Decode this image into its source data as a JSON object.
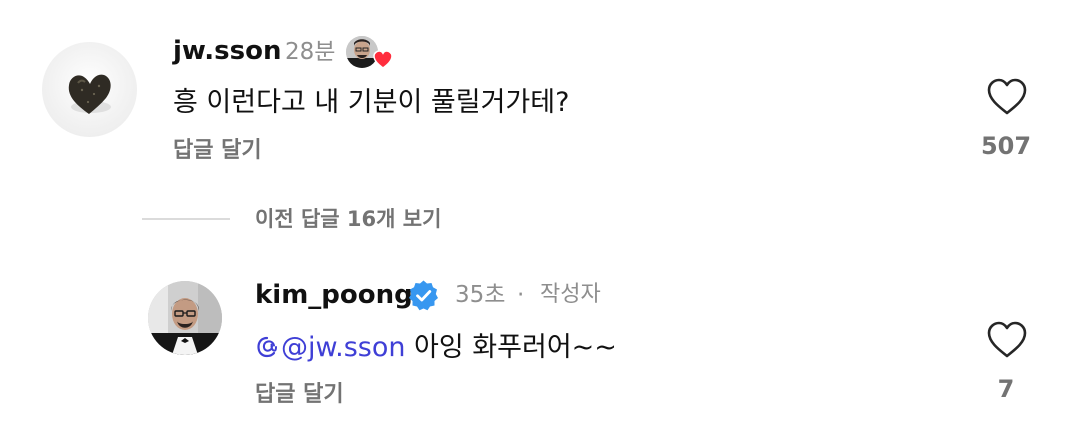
{
  "comments": [
    {
      "username": "jw.sson",
      "time": "28분",
      "text": "흥 이런다고 내 기분이 풀릴거가테?",
      "reply_label": "답글 달기",
      "like_count": "507",
      "liked_by_author": true
    },
    {
      "username": "kim_poong",
      "verified": true,
      "time": "35초",
      "separator": "·",
      "author_badge": "작성자",
      "mention": "@jw.sson",
      "text": " 아잉 화푸러어~~",
      "reply_label": "답글 달기",
      "like_count": "7"
    }
  ],
  "thread": {
    "view_previous_label": "이전 답글 16개 보기"
  },
  "icons": {
    "like": "heart-outline-icon",
    "verified": "verified-badge-icon",
    "mention": "threads-at-icon",
    "liked_by_author": "author-heart-icon"
  },
  "colors": {
    "text_primary": "#111111",
    "text_secondary": "#737373",
    "timestamp": "#8e8e8e",
    "mention": "#3f3fd6",
    "verified": "#3797f0",
    "heart_red": "#ff2d3d"
  }
}
